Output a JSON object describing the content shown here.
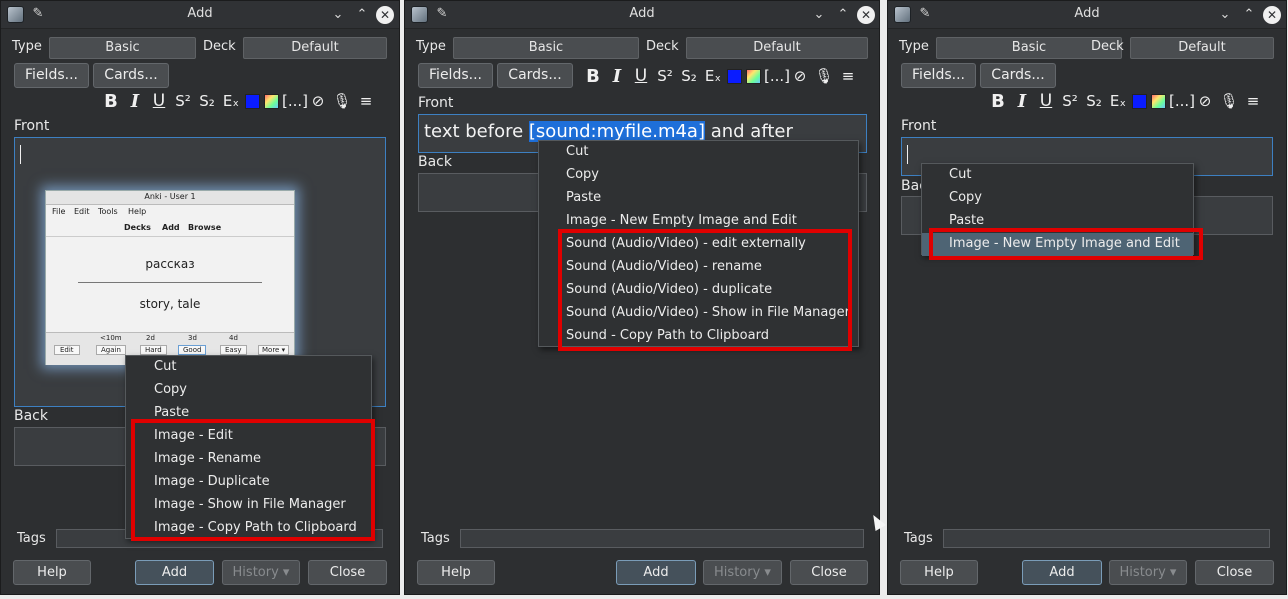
{
  "windows": [
    {
      "title": "Add",
      "type_label": "Type",
      "type_value": "Basic",
      "deck_label": "Deck",
      "deck_value": "Default",
      "fields_button": "Fields...",
      "cards_button": "Cards...",
      "front_label": "Front",
      "back_label": "Back",
      "tags_label": "Tags",
      "help_button": "Help",
      "add_button": "Add",
      "history_button": "History ▾",
      "close_button": "Close",
      "image_preview": {
        "title": "Anki - User 1",
        "menu": [
          "File",
          "Edit",
          "Tools",
          "Help"
        ],
        "nav": [
          "Decks",
          "Add",
          "Browse"
        ],
        "front": "рассказ",
        "back": "story, tale",
        "intervals": [
          "<10m",
          "2d",
          "3d",
          "4d"
        ],
        "buttons": [
          "Edit",
          "Again",
          "Hard",
          "Good",
          "Easy",
          "More ▾"
        ]
      },
      "context_menu": [
        "Cut",
        "Copy",
        "Paste",
        "Image - Edit",
        "Image - Rename",
        "Image - Duplicate",
        "Image - Show in File Manager",
        "Image - Copy Path to Clipboard"
      ]
    },
    {
      "title": "Add",
      "type_label": "Type",
      "type_value": "Basic",
      "deck_label": "Deck",
      "deck_value": "Default",
      "fields_button": "Fields...",
      "cards_button": "Cards...",
      "front_label": "Front",
      "back_label": "Back",
      "front_text_before": "text before ",
      "front_text_selected": "[sound:myfile.m4a]",
      "front_text_after": " and after",
      "tags_label": "Tags",
      "help_button": "Help",
      "add_button": "Add",
      "history_button": "History ▾",
      "close_button": "Close",
      "context_menu": [
        "Cut",
        "Copy",
        "Paste",
        "Image - New Empty Image and Edit",
        "Sound (Audio/Video) - edit externally",
        "Sound (Audio/Video) - rename",
        "Sound (Audio/Video) - duplicate",
        "Sound (Audio/Video) - Show in File Manager",
        "Sound - Copy Path to Clipboard"
      ]
    },
    {
      "title": "Add",
      "type_label": "Type",
      "type_value": "Basic",
      "deck_label": "Deck",
      "deck_value": "Default",
      "fields_button": "Fields...",
      "cards_button": "Cards...",
      "front_label": "Front",
      "back_label": "Bac",
      "tags_label": "Tags",
      "help_button": "Help",
      "add_button": "Add",
      "history_button": "History ▾",
      "close_button": "Close",
      "context_menu": [
        "Cut",
        "Copy",
        "Paste",
        "Image - New Empty Image and Edit"
      ]
    }
  ],
  "icons": {
    "format": [
      "bold-icon",
      "italic-icon",
      "underline-icon",
      "superscript-icon",
      "subscript-icon",
      "clear-format-icon",
      "text-color-icon",
      "highlight-color-icon",
      "cloze-icon",
      "attach-icon",
      "record-audio-icon",
      "more-icon"
    ],
    "titlebar": [
      "anki-app-icon",
      "pin-icon",
      "minimize-icon",
      "maximize-icon",
      "close-icon"
    ]
  },
  "colors": {
    "highlight_box": "#e00000",
    "selection": "#1e6fd9",
    "text_color_swatch": "#0a1cff"
  }
}
